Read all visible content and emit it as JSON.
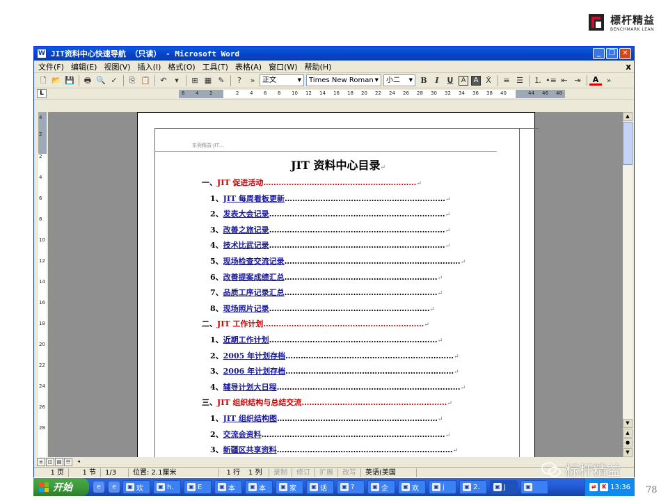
{
  "brand": {
    "name_cn": "標杆精益",
    "name_en": "BENCHMARK LEAN",
    "registered": "®"
  },
  "window": {
    "title": "JIT资料中心快速导航 （只读） - Microsoft Word",
    "app_icon": "W",
    "buttons": {
      "minimize": "_",
      "restore": "❐",
      "close": "✕"
    }
  },
  "menubar": {
    "items": [
      "文件(F)",
      "编辑(E)",
      "视图(V)",
      "插入(I)",
      "格式(O)",
      "工具(T)",
      "表格(A)",
      "窗口(W)",
      "帮助(H)"
    ],
    "close": "x"
  },
  "toolbar": {
    "style_value": "正文",
    "font_value": "Times New Roman",
    "size_value": "小二",
    "bold": "B",
    "italic": "I",
    "underline": "U",
    "char_border": "A",
    "char_shading": "A",
    "font_color": "A",
    "overflow": "»"
  },
  "ruler": {
    "corner": "L",
    "h_numbers": [
      "6",
      "4",
      "2",
      "2",
      "4",
      "6",
      "8",
      "10",
      "12",
      "14",
      "16",
      "18",
      "20",
      "22",
      "24",
      "26",
      "28",
      "30",
      "32",
      "34",
      "36",
      "38",
      "40",
      "44",
      "46",
      "48"
    ],
    "v_numbers": [
      "4",
      "2",
      "2",
      "4",
      "6",
      "8",
      "10",
      "12",
      "14",
      "16",
      "18",
      "20",
      "22",
      "24",
      "26",
      "28"
    ]
  },
  "document": {
    "header_text": "东莞精益-JIT…",
    "title": "JIT 资料中心目录",
    "para_mark": "↵",
    "entries": [
      {
        "type": "section",
        "num": "一、",
        "text": "JIT 促进活动",
        "dots": "……………………………………………………"
      },
      {
        "type": "item",
        "num": "1、",
        "text": "JIT 每周看板更新",
        "dots": "………………………………………………………"
      },
      {
        "type": "item",
        "num": "2、",
        "text": "发表大会记录",
        "dots": "……………………………………………………………"
      },
      {
        "type": "item",
        "num": "3、",
        "text": "改善之旅记录",
        "dots": "……………………………………………………………"
      },
      {
        "type": "item",
        "num": "4、",
        "text": "技术比武记录",
        "dots": "……………………………………………………………"
      },
      {
        "type": "item",
        "num": "5、",
        "text": "现场检查交流记录",
        "dots": "……………………………………………………………"
      },
      {
        "type": "item",
        "num": "6、",
        "text": "改善提案成绩汇总",
        "dots": "……………………………………………………"
      },
      {
        "type": "item",
        "num": "7、",
        "text": "品质工序记录汇总",
        "dots": "……………………………………………………"
      },
      {
        "type": "item",
        "num": "8、",
        "text": "现场照片记录",
        "dots": "………………………………………………………"
      },
      {
        "type": "section",
        "num": "二、",
        "text": "JIT 工作计划",
        "dots": "………………………………………………………"
      },
      {
        "type": "item",
        "num": "1、",
        "text": "近期工作计划",
        "dots": "…………………………………………………………"
      },
      {
        "type": "item",
        "num": "2、",
        "text": "2005 年计划存档",
        "dots": "…………………………………………………………"
      },
      {
        "type": "item",
        "num": "3、",
        "text": "2006 年计划存档",
        "dots": "…………………………………………………………"
      },
      {
        "type": "item",
        "num": "4、",
        "text": "辅导计划大日程",
        "dots": "………………………………………………………………"
      },
      {
        "type": "section",
        "num": "三、",
        "text": "JIT 组织结构与总结交流",
        "dots": "…………………………………………………"
      },
      {
        "type": "item",
        "num": "1、",
        "text": "JIT 组织结构图",
        "dots": "………………………………………………………"
      },
      {
        "type": "item",
        "num": "2、",
        "text": "交流会资料",
        "dots": "………………………………………………………………"
      },
      {
        "type": "item",
        "num": "3、",
        "text": "新疆区共享资料",
        "dots": "……………………………………………………………"
      }
    ]
  },
  "statusbar": {
    "page": "1 页",
    "section": "1 节",
    "pages": "1/3",
    "position": "位置: 2.1厘米",
    "line": "1 行",
    "col": "1 列",
    "rec": "录制",
    "trk": "修订",
    "ext": "扩展",
    "ovr": "改写",
    "language": "英语(美国"
  },
  "taskbar": {
    "start": "开始",
    "quick_launch": [
      "e",
      "e"
    ],
    "tasks": [
      "欢",
      "h.",
      "E",
      "本",
      "本",
      "家",
      "话",
      "?",
      "企",
      "欢",
      "j",
      "2.",
      "J",
      ""
    ],
    "clock": "13:36"
  },
  "watermark": {
    "text": "标杆精益"
  },
  "slide_number": "78"
}
